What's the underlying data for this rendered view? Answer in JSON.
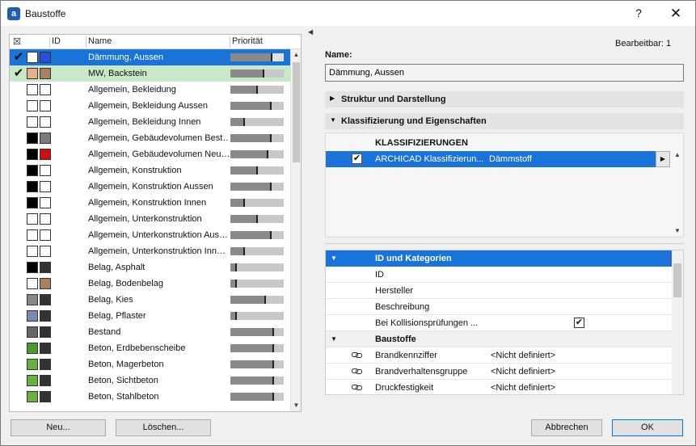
{
  "window": {
    "title": "Baustoffe",
    "help": "?",
    "close": "✕",
    "app_icon": "archicad-icon"
  },
  "list": {
    "headers": {
      "icon": "☒",
      "id": "ID",
      "name": "Name",
      "priority": "Priorität"
    },
    "rows": [
      {
        "name": "Dämmung, Aussen",
        "checked": true,
        "selected": "primary",
        "sw1": "#ffffff",
        "sw2": "#2a4fd8",
        "prio": 0.78,
        "mark": 0.78
      },
      {
        "name": "MW, Backstein",
        "checked": true,
        "selected": "secondary",
        "sw1": "#e8b08a",
        "sw2": "#a88060",
        "prio": 0.62,
        "mark": 0.62
      },
      {
        "name": "Allgemein, Bekleidung",
        "checked": false,
        "sw1": "#ffffff",
        "sw2": "#ffffff",
        "prio": 0.5,
        "mark": 0.5
      },
      {
        "name": "Allgemein, Bekleidung Aussen",
        "checked": false,
        "sw1": "#ffffff",
        "sw2": "#ffffff",
        "prio": 0.75,
        "mark": 0.75
      },
      {
        "name": "Allgemein, Bekleidung Innen",
        "checked": false,
        "sw1": "#ffffff",
        "sw2": "#ffffff",
        "prio": 0.25,
        "mark": 0.25
      },
      {
        "name": "Allgemein, Gebäudevolumen Best…",
        "checked": false,
        "sw1": "#000000",
        "sw2": "#7a7a7a",
        "prio": 0.75,
        "mark": 0.75
      },
      {
        "name": "Allgemein, Gebäudevolumen Neu…",
        "checked": false,
        "sw1": "#000000",
        "sw2": "#cc1010",
        "prio": 0.7,
        "mark": 0.7
      },
      {
        "name": "Allgemein, Konstruktion",
        "checked": false,
        "sw1": "#000000",
        "sw2": "#ffffff",
        "prio": 0.5,
        "mark": 0.5
      },
      {
        "name": "Allgemein, Konstruktion Aussen",
        "checked": false,
        "sw1": "#000000",
        "sw2": "#ffffff",
        "prio": 0.75,
        "mark": 0.75
      },
      {
        "name": "Allgemein, Konstruktion Innen",
        "checked": false,
        "sw1": "#000000",
        "sw2": "#ffffff",
        "prio": 0.25,
        "mark": 0.25
      },
      {
        "name": "Allgemein, Unterkonstruktion",
        "checked": false,
        "sw1": "#ffffff",
        "sw2": "#ffffff",
        "prio": 0.5,
        "mark": 0.5
      },
      {
        "name": "Allgemein, Unterkonstruktion Aus…",
        "checked": false,
        "sw1": "#ffffff",
        "sw2": "#ffffff",
        "prio": 0.75,
        "mark": 0.75
      },
      {
        "name": "Allgemein, Unterkonstruktion Inn…",
        "checked": false,
        "sw1": "#ffffff",
        "sw2": "#ffffff",
        "prio": 0.25,
        "mark": 0.25
      },
      {
        "name": "Belag, Asphalt",
        "checked": false,
        "sw1": "#000000",
        "sw2": "#333333",
        "prio": 0.1,
        "mark": 0.1
      },
      {
        "name": "Belag, Bodenbelag",
        "checked": false,
        "sw1": "#ffffff",
        "sw2": "#a88060",
        "prio": 0.1,
        "mark": 0.1
      },
      {
        "name": "Belag, Kies",
        "checked": false,
        "sw1": "#888888",
        "sw2": "#333333",
        "prio": 0.65,
        "mark": 0.65
      },
      {
        "name": "Belag, Pflaster",
        "checked": false,
        "sw1": "#7a8ab0",
        "sw2": "#333333",
        "prio": 0.1,
        "mark": 0.1
      },
      {
        "name": "Bestand",
        "checked": false,
        "sw1": "#666666",
        "sw2": "#333333",
        "prio": 0.8,
        "mark": 0.8
      },
      {
        "name": "Beton, Erdbebenscheibe",
        "checked": false,
        "sw1": "#4a9a30",
        "sw2": "#333333",
        "prio": 0.8,
        "mark": 0.8
      },
      {
        "name": "Beton, Magerbeton",
        "checked": false,
        "sw1": "#6ab040",
        "sw2": "#333333",
        "prio": 0.8,
        "mark": 0.8
      },
      {
        "name": "Beton, Sichtbeton",
        "checked": false,
        "sw1": "#6ab040",
        "sw2": "#333333",
        "prio": 0.8,
        "mark": 0.8
      },
      {
        "name": "Beton, Stahlbeton",
        "checked": false,
        "sw1": "#6ab040",
        "sw2": "#333333",
        "prio": 0.8,
        "mark": 0.8
      }
    ]
  },
  "buttons": {
    "new": "Neu...",
    "delete": "Löschen...",
    "cancel": "Abbrechen",
    "ok": "OK"
  },
  "right": {
    "editable": "Bearbeitbar: 1",
    "name_label": "Name:",
    "name_value": "Dämmung, Aussen",
    "section1": "Struktur und Darstellung",
    "section2": "Klassifizierung und Eigenschaften",
    "klass_header": "KLASSIFIZIERUNGEN",
    "klass_system": "ARCHICAD Klassifizierun...",
    "klass_value": "Dämmstoff"
  },
  "properties": {
    "group1": "ID und Kategorien",
    "rows1": [
      {
        "label": "ID"
      },
      {
        "label": "Hersteller"
      },
      {
        "label": "Beschreibung"
      },
      {
        "label": "Bei Kollisionsprüfungen ...",
        "checkbox": true
      }
    ],
    "group2": "Baustoffe",
    "rows2": [
      {
        "label": "Brandkennziffer",
        "value": "<Nicht definiert>"
      },
      {
        "label": "Brandverhaltensgruppe",
        "value": "<Nicht definiert>"
      },
      {
        "label": "Druckfestigkeit",
        "value": "<Nicht definiert>"
      }
    ]
  }
}
